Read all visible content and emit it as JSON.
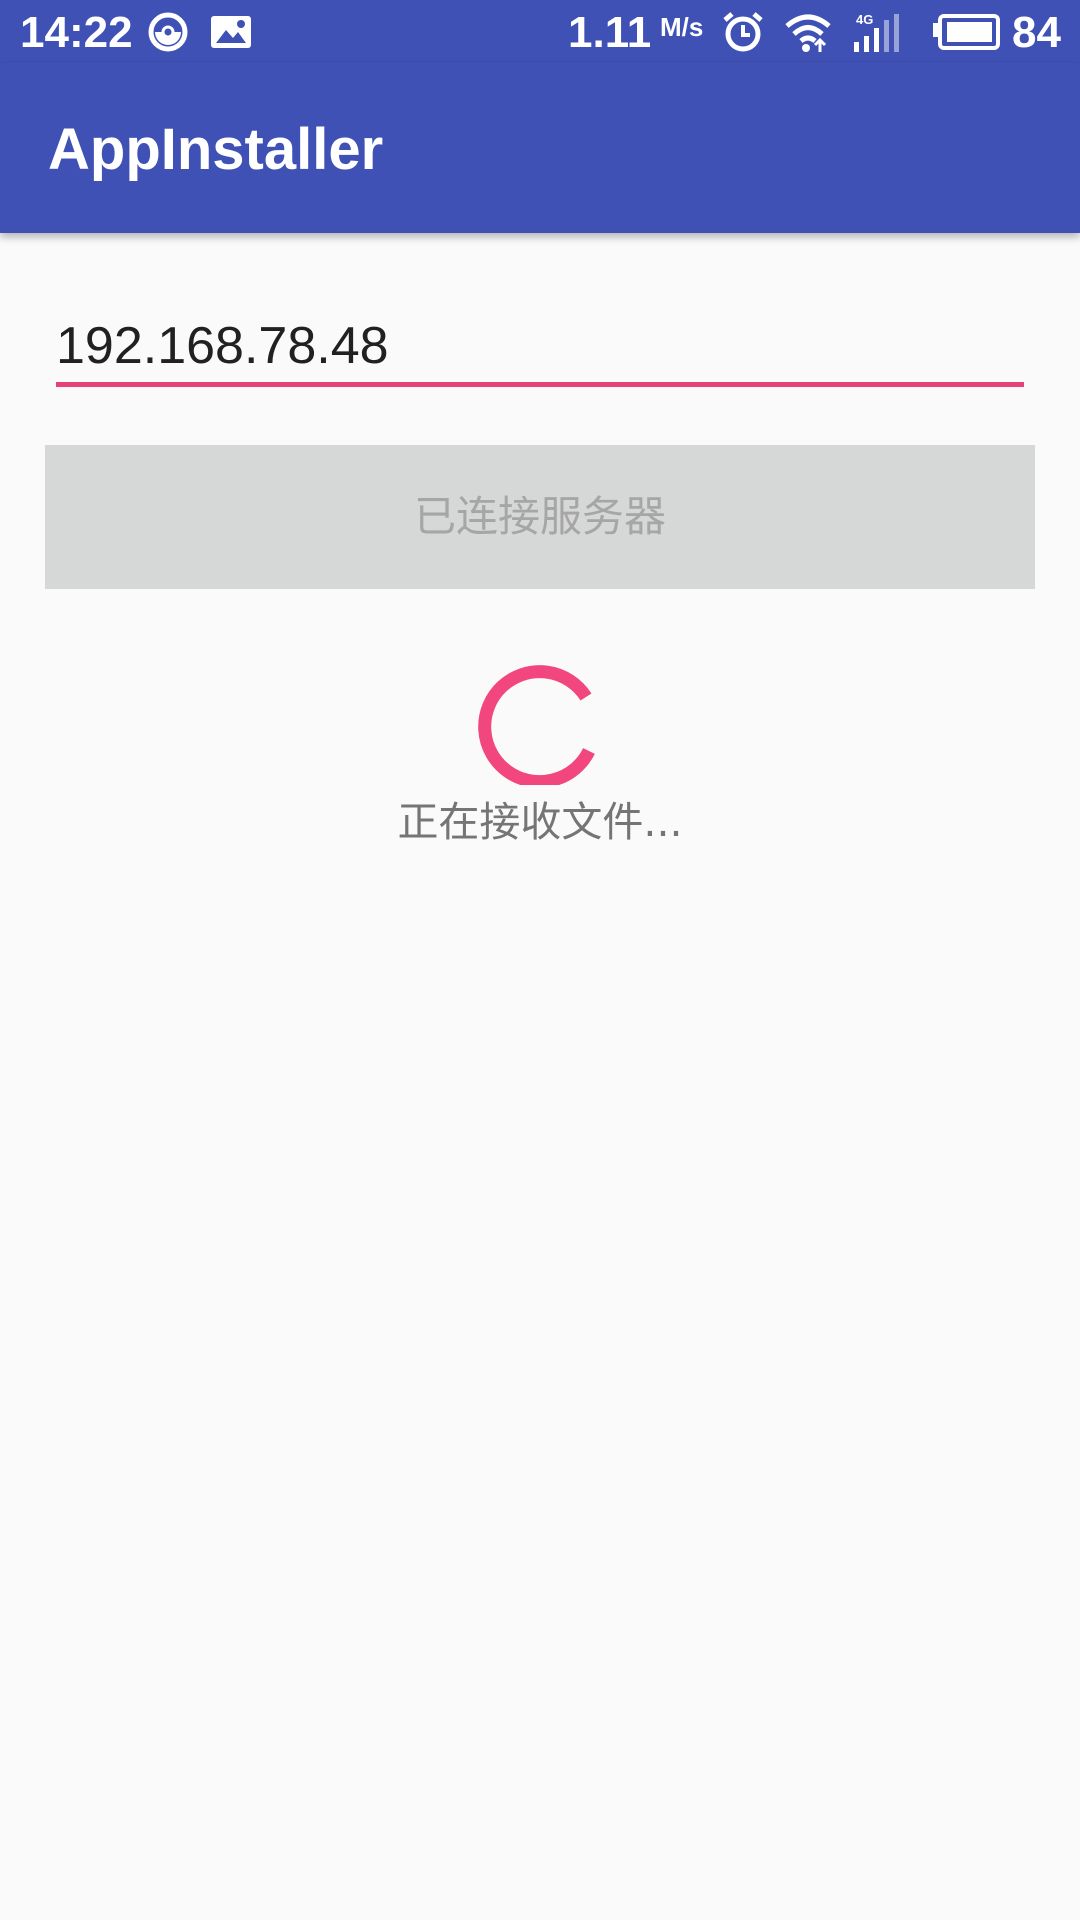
{
  "status_bar": {
    "time": "14:22",
    "net_speed": "1.11",
    "net_speed_unit": "M/s",
    "network_type": "4G",
    "battery": "84",
    "icons": [
      "pokeball-notification-icon",
      "image-notification-icon",
      "alarm-icon",
      "wifi-icon",
      "cell-signal-icon",
      "battery-icon"
    ]
  },
  "app_bar": {
    "title": "AppInstaller"
  },
  "server_input": {
    "value": "192.168.78.48"
  },
  "connect_button": {
    "label": "已连接服务器"
  },
  "progress": {
    "status": "正在接收文件..."
  },
  "colors": {
    "primary": "#3f51b5",
    "accent": "#ff4081",
    "underline": "#e7417a",
    "button_disabled_bg": "#d6d7d7",
    "button_disabled_text": "#a6a6a6",
    "background": "#fafafa"
  }
}
